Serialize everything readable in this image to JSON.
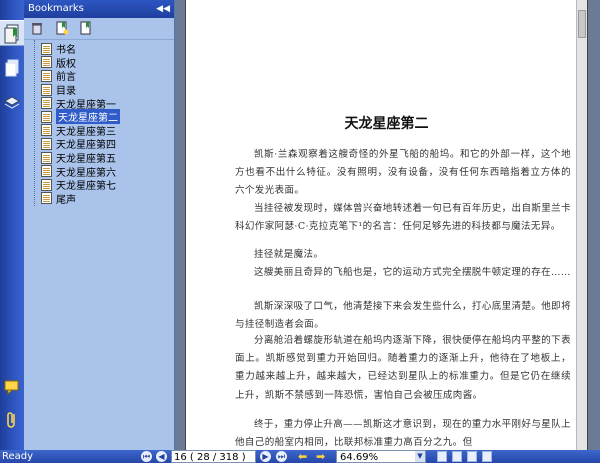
{
  "panel": {
    "title": "Bookmarks",
    "collapse_glyph": "◀◀",
    "toolbar_icons": [
      "delete-icon",
      "new-bookmark-icon",
      "bookmark-properties-icon"
    ]
  },
  "rail": {
    "icons": [
      "bookmarks-tab-icon",
      "pages-tab-icon",
      "layers-tab-icon",
      "comments-tab-icon",
      "attachments-tab-icon"
    ]
  },
  "bookmarks": [
    {
      "label": "书名"
    },
    {
      "label": "版权"
    },
    {
      "label": "前言"
    },
    {
      "label": "目录"
    },
    {
      "label": "天龙星座第一"
    },
    {
      "label": "天龙星座第二",
      "selected": true
    },
    {
      "label": "天龙星座第三"
    },
    {
      "label": "天龙星座第四"
    },
    {
      "label": "天龙星座第五"
    },
    {
      "label": "天龙星座第六"
    },
    {
      "label": "天龙星座第七"
    },
    {
      "label": "尾声"
    }
  ],
  "document": {
    "chapter_title": "天龙星座第二",
    "paragraphs": [
      "凯斯·兰森观察着这艘奇怪的外星飞船的船坞。和它的外部一样，这个地方也看不出什么特征。没有照明，没有设备，没有任何东西暗指着立方体的六个发光表面。",
      "当挂径被发现时，媒体曾兴奋地转述着一句已有百年历史，出自斯里兰卡科幻作家阿瑟·C·克拉克笔下¹的名言：任何足够先进的科技都与魔法无异。",
      "挂径就是魔法。",
      "这艘美丽且奇异的飞船也是，它的运动方式完全摆脱牛顿定理的存在……",
      "凯斯深深吸了口气，他清楚接下来会发生些什么，打心底里清楚。他即将与挂径制造者会面。",
      "分离舱沿着螺旋形轨道在船坞内逐渐下降，很快便停在船坞内平整的下表面上。凯斯感觉到重力开始回归。随着重力的逐渐上升，他待在了地板上，重力越来越上升，越来越大，已经达到星队上的标准重力。但是它仍在继续上升，凯斯不禁感到一阵恐慌，害怕自己会被压成肉酱。",
      "终于，重力停止升高——凯斯这才意识到，现在的重力水平刚好与星队上他自己的船室内相同，比联邦标准重力高百分之九。但"
    ]
  },
  "status": {
    "ready": "Ready",
    "page_indicator": "16 ( 28 / 318 )",
    "zoom": "64.69%"
  },
  "colors": {
    "accent": "#2f57c2",
    "panel_bg": "#a9c3ea",
    "selection": "#2f5cc9",
    "status_bg": "#3d66cc"
  }
}
